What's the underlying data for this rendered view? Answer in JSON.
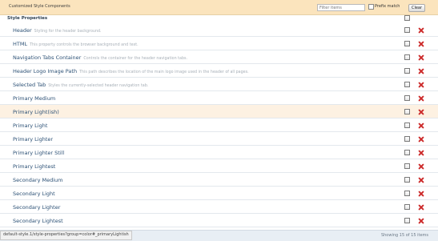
{
  "header": {
    "title": "Customized Style Components",
    "filter_placeholder": "Filter items",
    "prefix_match_label": "Prefix match",
    "clear_label": "Clear"
  },
  "group": {
    "label": "Style Properties"
  },
  "rows": [
    {
      "name": "Header",
      "desc": "Styling for the header background."
    },
    {
      "name": "HTML",
      "desc": "This property controls the browser background and text."
    },
    {
      "name": "Navigation Tabs Container",
      "desc": "Controls the container for the header navigation tabs."
    },
    {
      "name": "Header Logo Image Path",
      "desc": "This path describes the location of the main logo image used in the header of all pages."
    },
    {
      "name": "Selected Tab",
      "desc": "Styles the currently-selected header navigation tab."
    },
    {
      "name": "Primary Medium",
      "desc": ""
    },
    {
      "name": "Primary Light(ish)",
      "desc": ""
    },
    {
      "name": "Primary Light",
      "desc": ""
    },
    {
      "name": "Primary Lighter",
      "desc": ""
    },
    {
      "name": "Primary Lighter Still",
      "desc": ""
    },
    {
      "name": "Primary Lightest",
      "desc": ""
    },
    {
      "name": "Secondary Medium",
      "desc": ""
    },
    {
      "name": "Secondary Light",
      "desc": ""
    },
    {
      "name": "Secondary Lighter",
      "desc": ""
    },
    {
      "name": "Secondary Lightest",
      "desc": ""
    }
  ],
  "footer": {
    "status": "Showing 15 of 15 items",
    "url": "default-style.1/style-properties?group=color#_primaryLightish"
  },
  "colors": {
    "header_bg": "#fbe4bd",
    "highlight_row": "#fdf1e2",
    "delete_red": "#cc2a2a"
  }
}
